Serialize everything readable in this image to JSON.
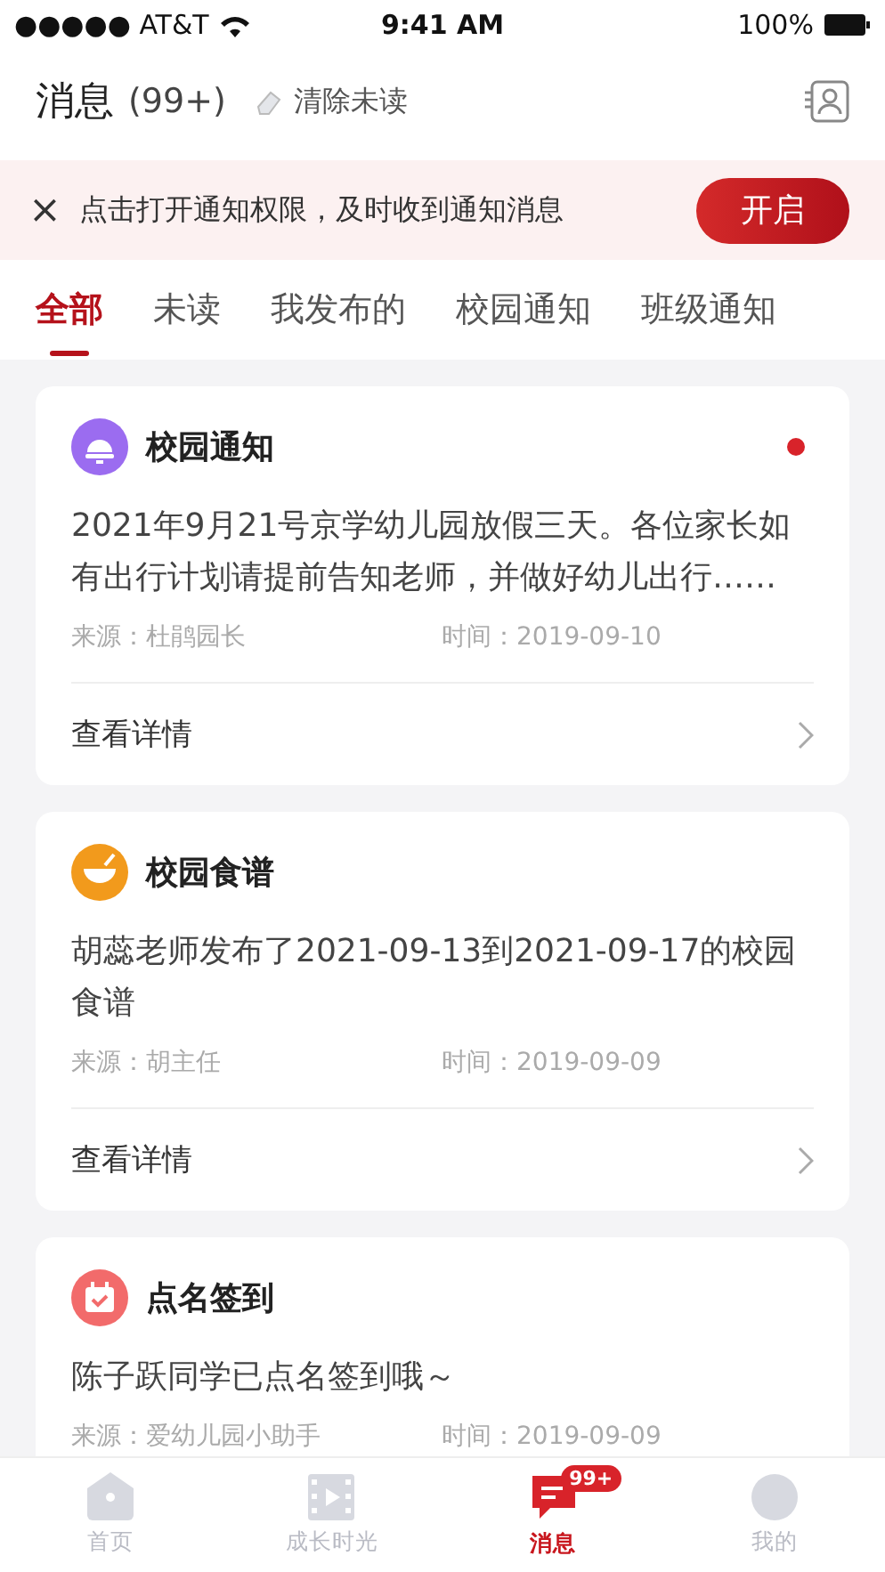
{
  "status_bar": {
    "carrier": "●●●●● AT&T",
    "time": "9:41 AM",
    "battery": "100%"
  },
  "header": {
    "title": "消息",
    "count": "(99+)",
    "clear_label": "清除未读"
  },
  "banner": {
    "close": "×",
    "text": "点击打开通知权限，及时收到通知消息",
    "button": "开启"
  },
  "tabs": [
    {
      "label": "全部",
      "selected": true
    },
    {
      "label": "未读",
      "selected": false
    },
    {
      "label": "我发布的",
      "selected": false
    },
    {
      "label": "校园通知",
      "selected": false
    },
    {
      "label": "班级通知",
      "selected": false
    }
  ],
  "cards": [
    {
      "kind": "bell",
      "title": "校园通知",
      "unread": true,
      "body": "2021年9月21号京学幼儿园放假三天。各位家长如有出行计划请提前告知老师，并做好幼儿出行……",
      "source": "来源：杜鹃园长",
      "time": "时间：2019-09-10",
      "details": "查看详情"
    },
    {
      "kind": "bowl",
      "title": "校园食谱",
      "unread": false,
      "body": "胡蕊老师发布了2021-09-13到2021-09-17的校园食谱",
      "source": "来源：胡主任",
      "time": "时间：2019-09-09",
      "details": "查看详情"
    },
    {
      "kind": "calendar",
      "title": "点名签到",
      "unread": false,
      "body": "陈子跃同学已点名签到哦～",
      "source": "来源：爱幼儿园小助手",
      "time": "时间：2019-09-09"
    }
  ],
  "nav": [
    {
      "kind": "home",
      "label": "首页",
      "selected": false
    },
    {
      "kind": "film",
      "label": "成长时光",
      "selected": false
    },
    {
      "kind": "message",
      "label": "消息",
      "selected": true,
      "badge": "99+"
    },
    {
      "kind": "person",
      "label": "我的",
      "selected": false
    }
  ]
}
